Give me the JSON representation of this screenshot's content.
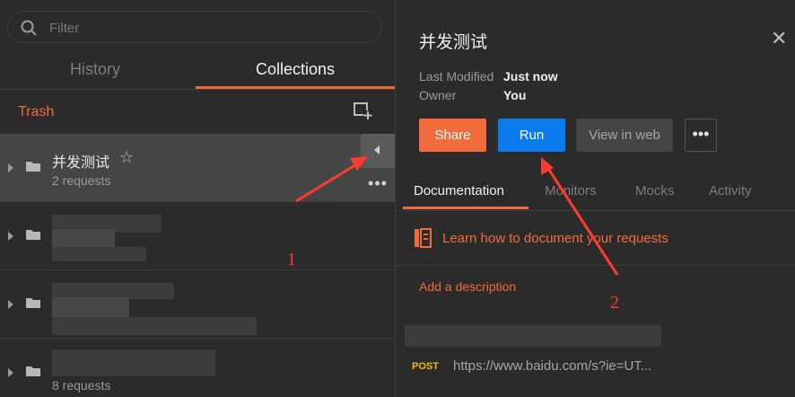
{
  "left_panel": {
    "filter": {
      "placeholder": "Filter"
    },
    "tabs": [
      {
        "label": "History",
        "active": false
      },
      {
        "label": "Collections",
        "active": true
      }
    ],
    "trash_label": "Trash",
    "collections": [
      {
        "name": "并发测试",
        "count": "2 requests",
        "selected": true
      },
      {
        "name": "",
        "count": "",
        "blurred": true
      },
      {
        "name": "",
        "count": "",
        "blurred": true
      },
      {
        "name": "",
        "count": "8 requests",
        "blurred": true
      }
    ]
  },
  "right_panel": {
    "title": "并发测试",
    "meta": [
      {
        "label": "Last Modified",
        "value": "Just now"
      },
      {
        "label": "Owner",
        "value": "You"
      }
    ],
    "buttons": {
      "share": "Share",
      "run": "Run",
      "view_in_web": "View in web",
      "more": "•••"
    },
    "tabs": [
      "Documentation",
      "Monitors",
      "Mocks",
      "Activity"
    ],
    "learn_link": "Learn how to document your requests",
    "add_description": "Add a description",
    "request": {
      "method": "POST",
      "url": "https://www.baidu.com/s?ie=UT..."
    }
  },
  "annotations": [
    "1",
    "2"
  ],
  "colors": {
    "accent": "#f26b3a",
    "run_blue": "#097bed",
    "post_method": "#f5b800",
    "annotation_red": "#ff3b30"
  }
}
